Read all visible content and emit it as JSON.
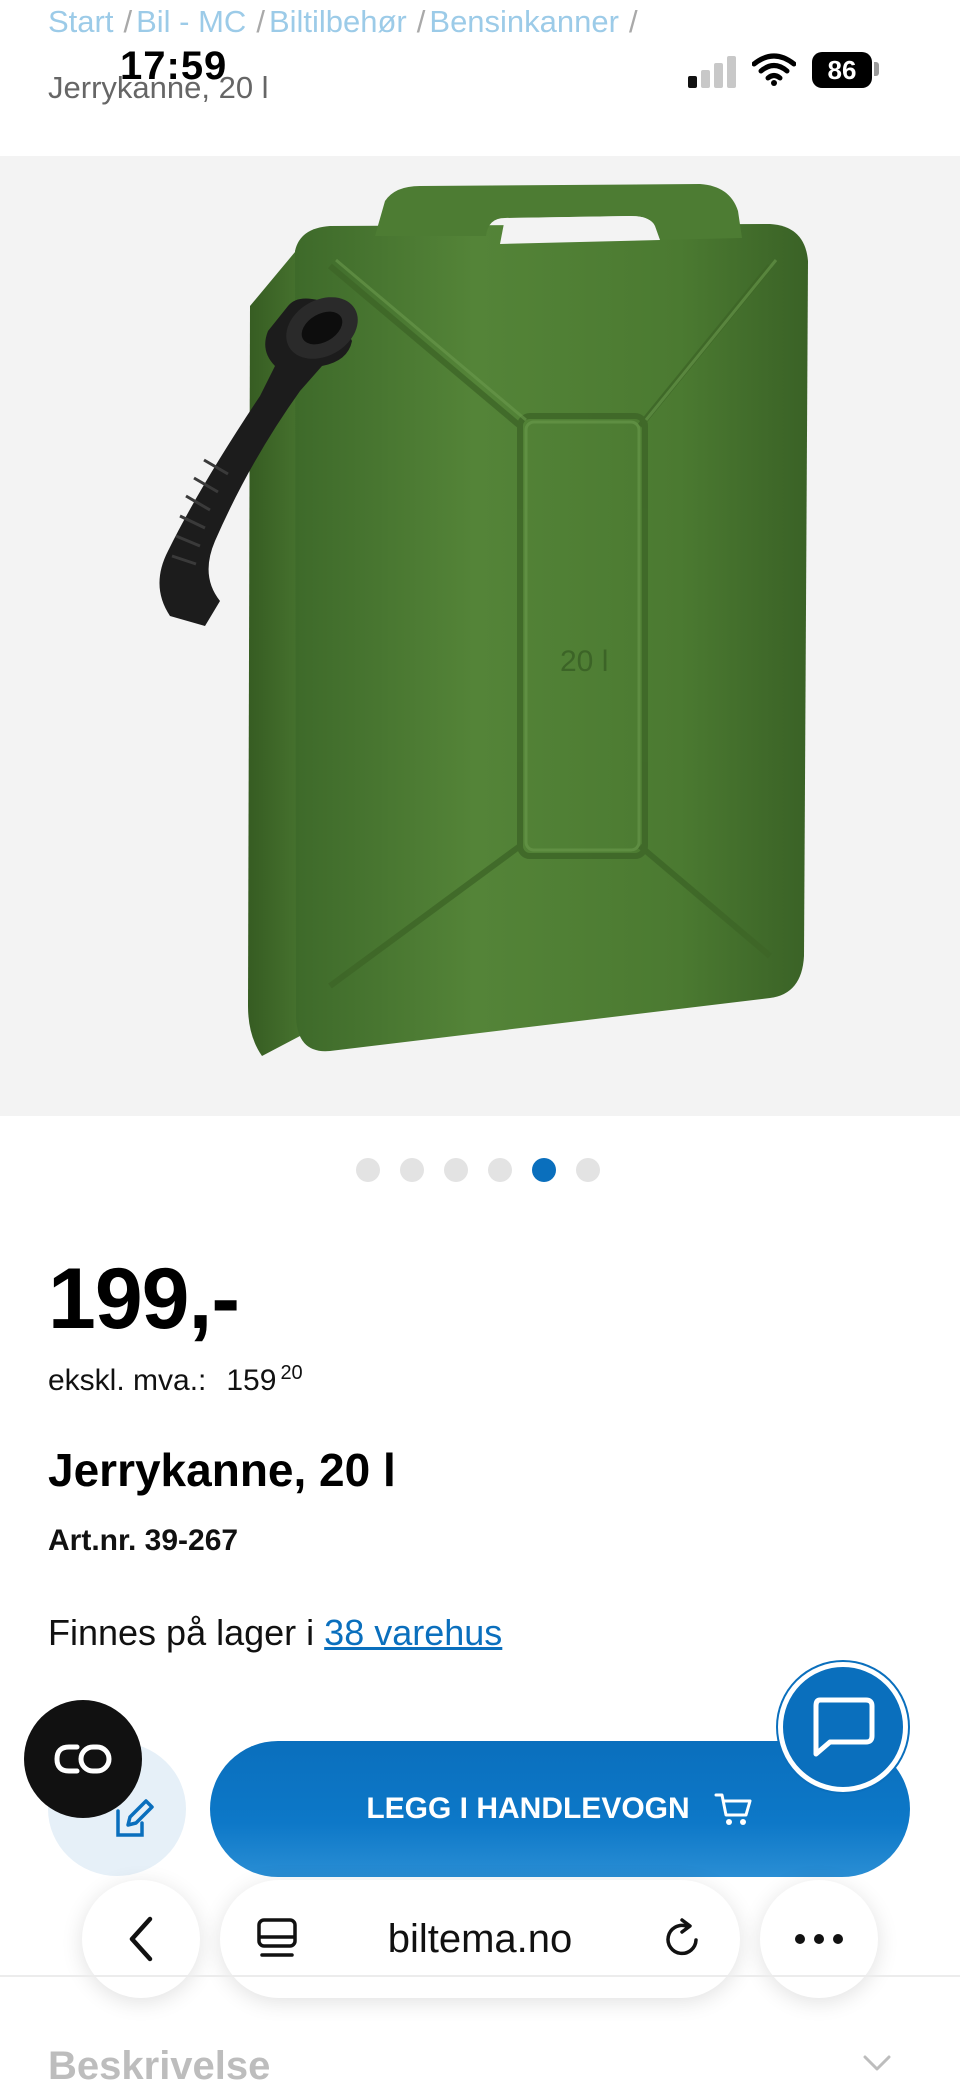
{
  "status_bar": {
    "time": "17:59",
    "battery": "86"
  },
  "breadcrumb": {
    "items": [
      "Start",
      "Bil - MC",
      "Biltilbehør",
      "Bensinkanner"
    ],
    "separator": "/",
    "current": "Jerrykanne, 20 l"
  },
  "gallery": {
    "image_count": 6,
    "active_index": 4,
    "can_embossing": "20 l"
  },
  "product": {
    "price": "199,-",
    "excl_vat_label": "ekskl. mva.:",
    "excl_vat_main": "159",
    "excl_vat_cents": "20",
    "title": "Jerrykanne, 20 l",
    "article_number": "Art.nr. 39-267",
    "stock_prefix": "Finnes på lager i",
    "stock_link": "38 varehus"
  },
  "actions": {
    "add_to_cart_label": "LEGG I HANDLEVOGN"
  },
  "browser": {
    "url": "biltema.no"
  },
  "sections": {
    "description_title": "Beskrivelse"
  },
  "colors": {
    "accent": "#0a6fbd",
    "can_green": "#4d7a34",
    "breadcrumb_link": "#9ccbe8"
  }
}
